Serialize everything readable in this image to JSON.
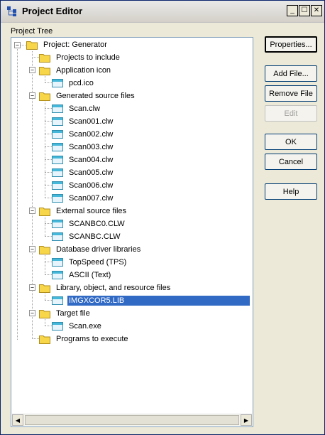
{
  "window": {
    "title": "Project Editor",
    "controls": {
      "minimize": "_",
      "maximize": "☐",
      "close": "✕"
    }
  },
  "tree_label": "Project Tree",
  "tree": {
    "root": "Project: Generator",
    "projects_to_include": "Projects to include",
    "application_icon": "Application icon",
    "pcd_ico": "pcd.ico",
    "generated_source_files": "Generated source files",
    "scan_clw": "Scan.clw",
    "scan001": "Scan001.clw",
    "scan002": "Scan002.clw",
    "scan003": "Scan003.clw",
    "scan004": "Scan004.clw",
    "scan005": "Scan005.clw",
    "scan006": "Scan006.clw",
    "scan007": "Scan007.clw",
    "external_source_files": "External source files",
    "scanbc0": "SCANBC0.CLW",
    "scanbc": "SCANBC.CLW",
    "database_driver_libraries": "Database driver libraries",
    "topspeed": "TopSpeed (TPS)",
    "ascii": "ASCII (Text)",
    "library_files": "Library, object, and resource files",
    "imgxcor5": "IMGXCOR5.LIB",
    "target_file": "Target file",
    "scan_exe": "Scan.exe",
    "programs_to_execute": "Programs to execute"
  },
  "buttons": {
    "properties": "Properties...",
    "add_file": "Add File...",
    "remove_file": "Remove File",
    "edit": "Edit",
    "ok": "OK",
    "cancel": "Cancel",
    "help": "Help"
  },
  "colors": {
    "selection": "#316ac5",
    "window_bg": "#ece9d8",
    "folder": "#f7d64a"
  }
}
